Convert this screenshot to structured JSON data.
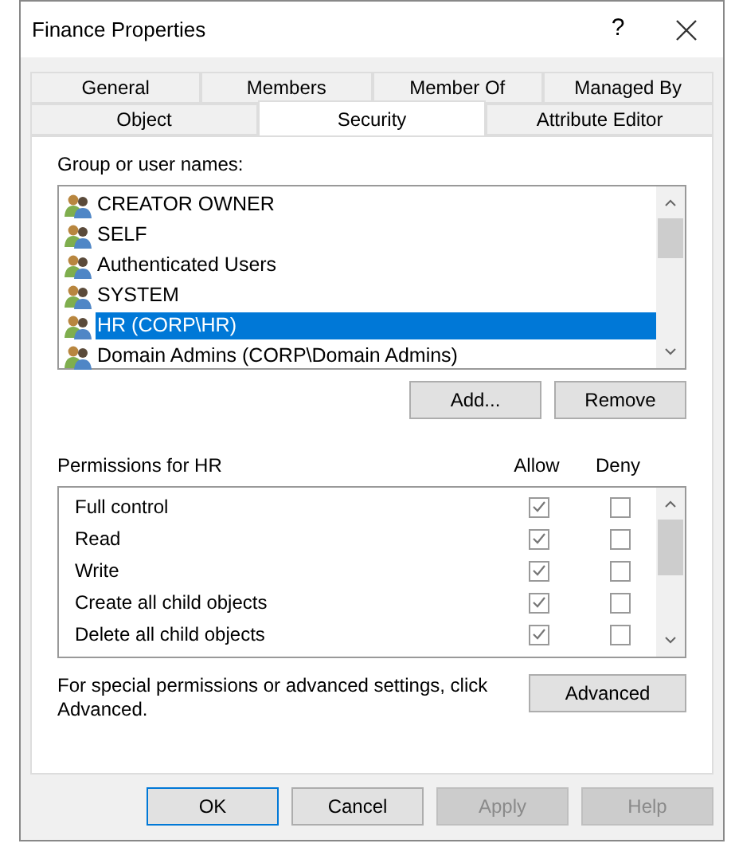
{
  "window": {
    "title": "Finance Properties",
    "help_glyph": "?"
  },
  "tabs": [
    [
      {
        "label": "General",
        "selected": false
      },
      {
        "label": "Members",
        "selected": false
      },
      {
        "label": "Member Of",
        "selected": false
      },
      {
        "label": "Managed By",
        "selected": false
      }
    ],
    [
      {
        "label": "Object",
        "selected": false
      },
      {
        "label": "Security",
        "selected": true
      },
      {
        "label": "Attribute Editor",
        "selected": false
      }
    ]
  ],
  "group_label": "Group or user names:",
  "groups": [
    {
      "name": "CREATOR OWNER",
      "selected": false
    },
    {
      "name": "SELF",
      "selected": false
    },
    {
      "name": "Authenticated Users",
      "selected": false
    },
    {
      "name": "SYSTEM",
      "selected": false
    },
    {
      "name": "HR (CORP\\HR)",
      "selected": true
    },
    {
      "name": "Domain Admins (CORP\\Domain Admins)",
      "selected": false
    }
  ],
  "group_buttons": [
    "Add...",
    "Remove"
  ],
  "permissions": {
    "title": "Permissions for HR",
    "allow_label": "Allow",
    "deny_label": "Deny",
    "rows": [
      {
        "name": "Full control",
        "allow": true,
        "deny": false
      },
      {
        "name": "Read",
        "allow": true,
        "deny": false
      },
      {
        "name": "Write",
        "allow": true,
        "deny": false
      },
      {
        "name": "Create all child objects",
        "allow": true,
        "deny": false
      },
      {
        "name": "Delete all child objects",
        "allow": true,
        "deny": false
      }
    ]
  },
  "advanced_note": "For special permissions or advanced settings, click Advanced.",
  "advanced_button": "Advanced",
  "buttons": [
    {
      "label": "OK",
      "kind": "default"
    },
    {
      "label": "Cancel",
      "kind": "normal"
    },
    {
      "label": "Apply",
      "kind": "disabled"
    },
    {
      "label": "Help",
      "kind": "disabled"
    }
  ]
}
